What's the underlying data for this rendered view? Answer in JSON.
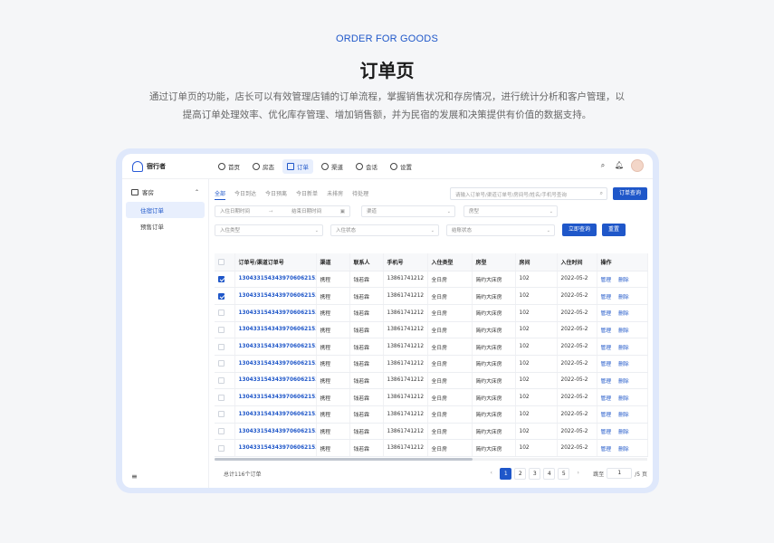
{
  "hero": {
    "eyebrow": "ORDER FOR GOODS",
    "title": "订单页",
    "description": "通过订单页的功能，店长可以有效管理店铺的订单流程，掌握销售状况和存房情况，进行统计分析和客户管理，以提高订单处理效率、优化库存管理、增加销售额，并为民宿的发展和决策提供有价值的数据支持。"
  },
  "app": {
    "brand": "宿行者",
    "nav": [
      "首页",
      "房态",
      "订单",
      "渠道",
      "会话",
      "设置"
    ],
    "nav_active_index": 2,
    "icons": [
      "search-icon",
      "bell-icon",
      "avatar"
    ]
  },
  "sidebar": {
    "group": "客房",
    "items": [
      "住宿订单",
      "预售订单"
    ],
    "active_index": 0,
    "footer_icon": "≡"
  },
  "filters": {
    "tabs": [
      "全部",
      "今日到达",
      "今日预离",
      "今日新单",
      "未排房",
      "待处理"
    ],
    "search_placeholder": "请输入订单号/渠道订单号/房间号/姓名/手机号查询",
    "search_button": "订单查询",
    "start_date": "入住日期时间",
    "end_date": "结束日期时间",
    "channel": "渠道",
    "room_type": "房型",
    "checkin_type": "入住类型",
    "checkin_status": "入住状态",
    "settle_status": "结账状态",
    "query_button": "立即查询",
    "reset_button": "重置"
  },
  "table": {
    "columns": [
      "订单号/渠道订单号",
      "渠道",
      "联系人",
      "手机号",
      "入住类型",
      "房型",
      "房间",
      "入住时间",
      "操作"
    ],
    "rows": [
      {
        "checked": true,
        "order": "1304331543439706062153",
        "channel": "携程",
        "contact": "钱若霖",
        "phone": "13861741212",
        "type": "全日房",
        "room_type": "简约大床房",
        "room": "102",
        "time": "2022-05-2"
      },
      {
        "checked": true,
        "order": "1304331543439706062153",
        "channel": "携程",
        "contact": "钱若霖",
        "phone": "13861741212",
        "type": "全日房",
        "room_type": "简约大床房",
        "room": "102",
        "time": "2022-05-2"
      },
      {
        "checked": false,
        "order": "1304331543439706062153",
        "channel": "携程",
        "contact": "钱若霖",
        "phone": "13861741212",
        "type": "全日房",
        "room_type": "简约大床房",
        "room": "102",
        "time": "2022-05-2"
      },
      {
        "checked": false,
        "order": "1304331543439706062153",
        "channel": "携程",
        "contact": "钱若霖",
        "phone": "13861741212",
        "type": "全日房",
        "room_type": "简约大床房",
        "room": "102",
        "time": "2022-05-2"
      },
      {
        "checked": false,
        "order": "1304331543439706062153",
        "channel": "携程",
        "contact": "钱若霖",
        "phone": "13861741212",
        "type": "全日房",
        "room_type": "简约大床房",
        "room": "102",
        "time": "2022-05-2"
      },
      {
        "checked": false,
        "order": "1304331543439706062153",
        "channel": "携程",
        "contact": "钱若霖",
        "phone": "13861741212",
        "type": "全日房",
        "room_type": "简约大床房",
        "room": "102",
        "time": "2022-05-2"
      },
      {
        "checked": false,
        "order": "1304331543439706062153",
        "channel": "携程",
        "contact": "钱若霖",
        "phone": "13861741212",
        "type": "全日房",
        "room_type": "简约大床房",
        "room": "102",
        "time": "2022-05-2"
      },
      {
        "checked": false,
        "order": "1304331543439706062153",
        "channel": "携程",
        "contact": "钱若霖",
        "phone": "13861741212",
        "type": "全日房",
        "room_type": "简约大床房",
        "room": "102",
        "time": "2022-05-2"
      },
      {
        "checked": false,
        "order": "1304331543439706062153",
        "channel": "携程",
        "contact": "钱若霖",
        "phone": "13861741212",
        "type": "全日房",
        "room_type": "简约大床房",
        "room": "102",
        "time": "2022-05-2"
      },
      {
        "checked": false,
        "order": "1304331543439706062153",
        "channel": "携程",
        "contact": "钱若霖",
        "phone": "13861741212",
        "type": "全日房",
        "room_type": "简约大床房",
        "room": "102",
        "time": "2022-05-2"
      },
      {
        "checked": false,
        "order": "1304331543439706062153",
        "channel": "携程",
        "contact": "钱若霖",
        "phone": "13861741212",
        "type": "全日房",
        "room_type": "简约大床房",
        "room": "102",
        "time": "2022-05-2"
      }
    ],
    "action_manage": "管理",
    "action_delete": "删除"
  },
  "pagination": {
    "total": "总计116个订单",
    "prev": "‹",
    "pages": [
      "1",
      "2",
      "3",
      "4",
      "5"
    ],
    "active_page": "1",
    "next": "›",
    "jump_label": "跳至",
    "jump_value": "1",
    "page_total": "/5 页"
  },
  "colors": {
    "accent": "#1f57c9",
    "frame": "#dfe8fb"
  }
}
